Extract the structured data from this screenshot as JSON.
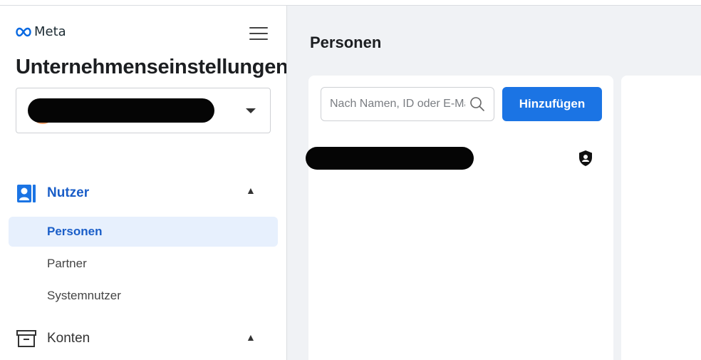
{
  "brand": {
    "logo_text": "Meta"
  },
  "sidebar": {
    "app_title": "Unternehmenseinstellungen",
    "sections": [
      {
        "label": "Nutzer",
        "icon": "users-icon",
        "expanded": true,
        "items": [
          {
            "label": "Personen",
            "active": true
          },
          {
            "label": "Partner",
            "active": false
          },
          {
            "label": "Systemnutzer",
            "active": false
          }
        ]
      },
      {
        "label": "Konten",
        "icon": "inbox-icon",
        "expanded": true,
        "items": []
      }
    ]
  },
  "main": {
    "title": "Personen",
    "search": {
      "placeholder": "Nach Namen, ID oder E-Mail-Adresse suchen",
      "value": ""
    },
    "add_button_label": "Hinzufügen",
    "people": [
      {
        "name_redacted": true,
        "role_icon": "admin-shield-icon"
      }
    ]
  },
  "colors": {
    "accent": "#1b74e4",
    "active_bg": "#e7f0fd",
    "active_text": "#1a5ec8",
    "page_bg": "#f0f2f5",
    "avatar": "#f0a06a"
  }
}
